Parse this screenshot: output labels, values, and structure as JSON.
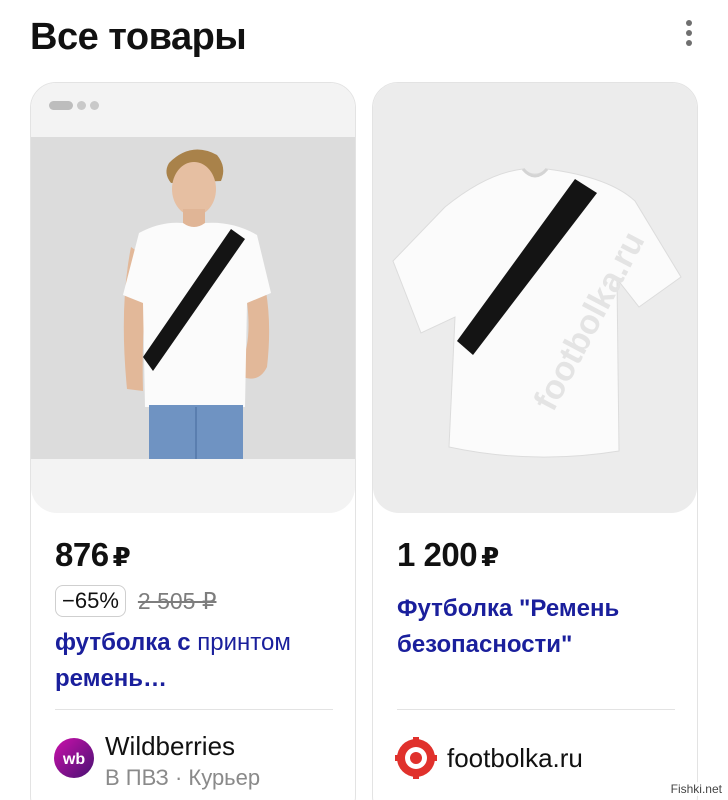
{
  "header": {
    "title": "Все товары",
    "menu_icon": "kebab-menu-icon"
  },
  "products": [
    {
      "price": "876",
      "currency": "₽",
      "discount": "−65%",
      "old_price": "2 505 ₽",
      "title_bold": "футболка с",
      "title_rest": " принтом",
      "title_line2": "ремень…",
      "shop": {
        "name": "Wildberries",
        "delivery": "В ПВЗ · Курьер",
        "logo_text": "wb",
        "logo_color": "#b3179c"
      }
    },
    {
      "price": "1 200",
      "currency": "₽",
      "title_line1": "Футболка \"Ремень",
      "title_line2": "безопасности\"",
      "image_watermark": "footbolka.ru",
      "shop": {
        "name": "footbolka.ru",
        "logo_color": "#e0312c"
      }
    }
  ],
  "watermark": "Fishki.net",
  "colors": {
    "link": "#1a1f9c",
    "muted": "#8a8a8a",
    "border": "#e3e3e3"
  }
}
